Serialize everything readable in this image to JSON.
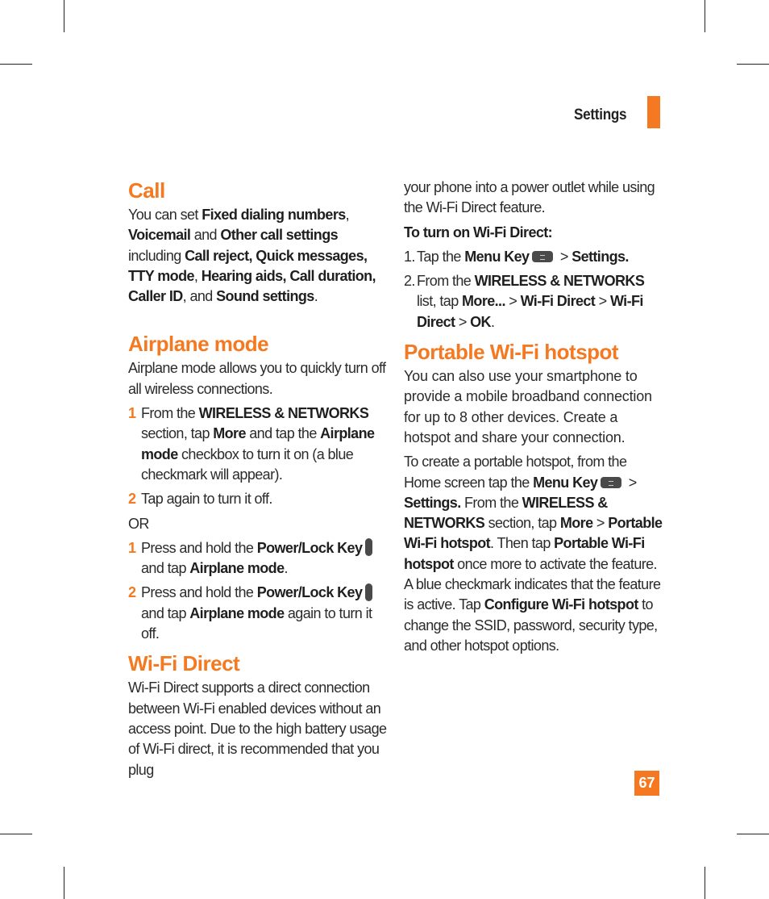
{
  "header": {
    "section": "Settings"
  },
  "page_number": "67",
  "left": {
    "call": {
      "title": "Call",
      "t1": "You can set ",
      "b1": "Fixed dialing numbers",
      "t2": ", ",
      "b2": "Voicemail",
      "t3": " and ",
      "b3": "Other call settings",
      "t4": " including ",
      "b4": "Call reject, Quick messages, TTY mode",
      "t5": ", ",
      "b5": "Hearing aids, Call duration, Caller ID",
      "t6": ", and ",
      "b6": "Sound settings",
      "t7": "."
    },
    "airplane": {
      "title": "Airplane mode",
      "intro": "Airplane mode allows you to quickly turn off all wireless connections.",
      "steps_a": [
        {
          "num": "1",
          "t1": "From the ",
          "b1": "WIRELESS & NETWORKS",
          "t2": " section, tap ",
          "b2": "More",
          "t3": " and tap the ",
          "b3": "Airplane mode",
          "t4": " checkbox to turn it on (a blue checkmark will appear)."
        },
        {
          "num": "2",
          "t1": "Tap again to turn it off."
        }
      ],
      "or": "OR",
      "steps_b": [
        {
          "num": "1",
          "t1": "Press and hold the ",
          "b1": "Power/Lock Key",
          "t2": " and tap ",
          "b2": "Airplane mode",
          "t3": "."
        },
        {
          "num": "2",
          "t1": "Press and hold the ",
          "b1": "Power/Lock Key",
          "t2": " and tap ",
          "b2": "Airplane mode",
          "t3": " again to turn it off."
        }
      ]
    },
    "wifi_direct": {
      "title": "Wi-Fi Direct",
      "body": "Wi-Fi Direct supports a direct connection between Wi-Fi enabled devices without an access point. Due to the high battery usage of Wi-Fi direct, it is recommended that you plug"
    }
  },
  "right": {
    "continued": "your phone into a power outlet while using the Wi-Fi Direct feature.",
    "turn_on_heading": "To turn on Wi-Fi Direct:",
    "steps": [
      {
        "num": "1.",
        "t1": "Tap the ",
        "b1": "Menu Key",
        "t2": " > ",
        "b2": "Settings."
      },
      {
        "num": "2.",
        "t1": "From the ",
        "b1": "WIRELESS & NETWORKS",
        "t2": " list, tap ",
        "b2": "More...",
        "t3": " > ",
        "b3": "Wi-Fi Direct",
        "t4": " > ",
        "b4": "Wi-Fi Direct",
        "t5": " > ",
        "b5": "OK",
        "t6": "."
      }
    ],
    "hotspot": {
      "title": "Portable Wi-Fi hotspot",
      "intro": "You can also use your smartphone to provide a mobile broadband connection for up to 8 other devices. Create a hotspot and share your connection.",
      "t1": "To create a portable hotspot, from the Home screen tap the ",
      "b1": "Menu Key",
      "t2": " > ",
      "b2": "Settings.",
      "t3": " From the ",
      "b3": "WIRELESS & NETWORKS",
      "t4": " section, tap ",
      "b4": "More",
      "t5": " > ",
      "b5": "Portable Wi-Fi hotspot",
      "t6": ". Then tap ",
      "b6": "Portable Wi-Fi hotspot",
      "t7": " once more to activate the feature. A blue checkmark indicates that the feature is active. Tap ",
      "b7": "Configure Wi-Fi hotspot",
      "t8": " to change the SSID, password, security type, and other hotspot options."
    }
  }
}
